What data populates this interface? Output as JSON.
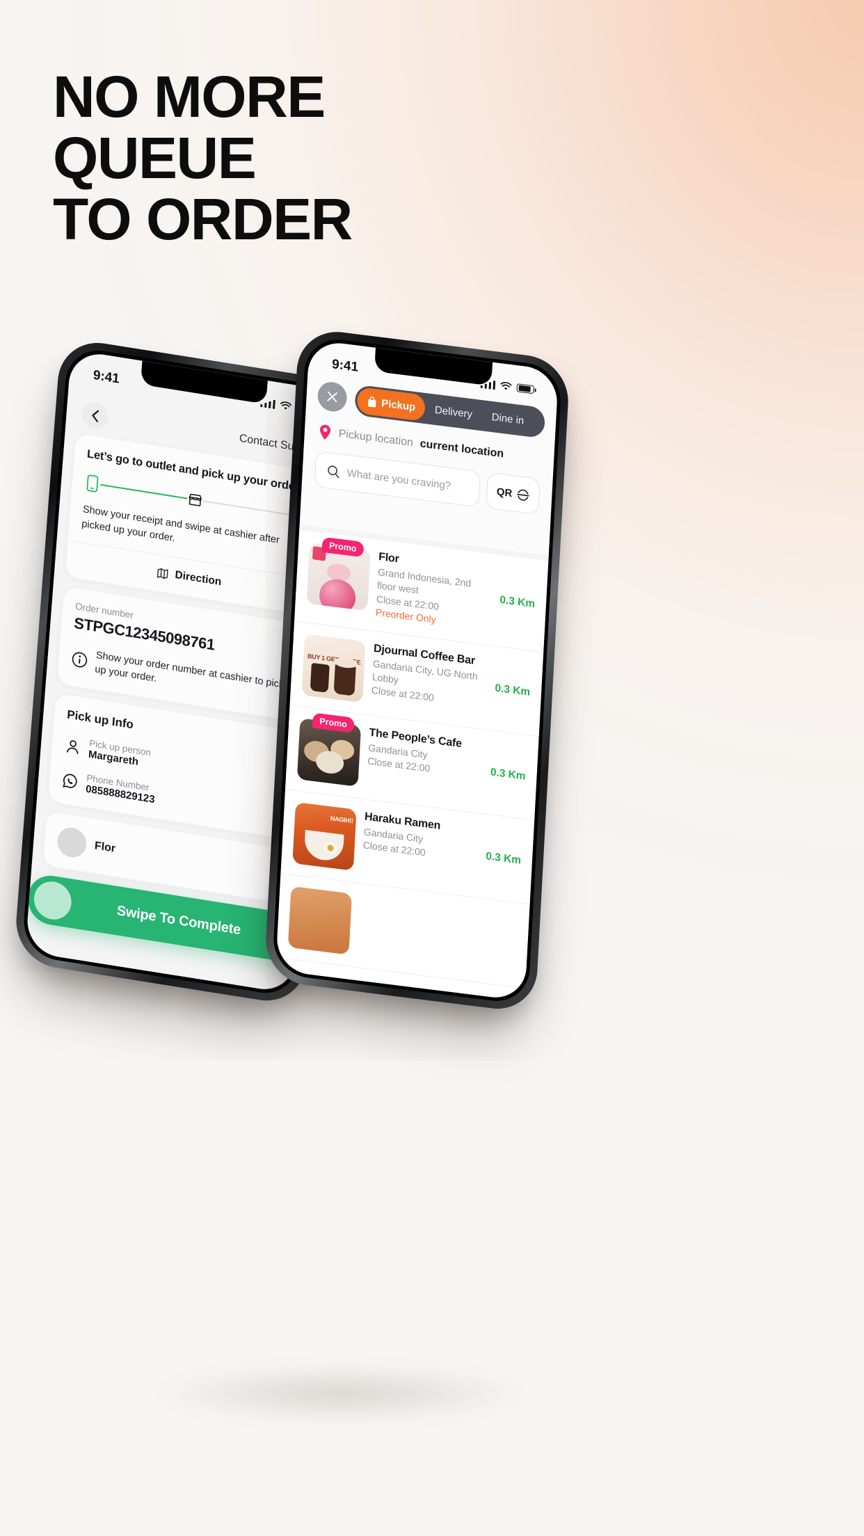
{
  "headline": {
    "line1": "NO MORE",
    "line2": "QUEUE",
    "line3": "TO ORDER"
  },
  "colors": {
    "accent_orange": "#f4711f",
    "promo_pink": "#f5246e",
    "distance_green": "#22b04b",
    "swipe_green": "#28b473",
    "preorder_orange": "#ef6e31",
    "tabs_dark": "#4c4f59"
  },
  "left_phone": {
    "status_bar": {
      "time": "9:41",
      "signal_icon": "cellular-bars-icon",
      "wifi_icon": "wifi-icon",
      "battery_icon": "battery-icon"
    },
    "header": {
      "back_icon": "chevron-left-icon",
      "support_label": "Contact Support"
    },
    "pickup_card": {
      "title": "Let’s go to outlet and pick up your order",
      "stepper": {
        "step1_icon": "phone-icon",
        "step2_icon": "store-icon",
        "step3_icon": "takeaway-bag-icon",
        "progress_done": 1
      },
      "subtitle": "Show your receipt and swipe at cashier after picked up your order.",
      "direction_icon": "map-icon",
      "direction_label": "Direction"
    },
    "order_card": {
      "label": "Order number",
      "value": "STPGC12345098761",
      "note_icon": "info-icon",
      "note": "Show your order number at cashier to pick-up your order."
    },
    "pickup_info": {
      "heading": "Pick up Info",
      "person_icon": "person-icon",
      "person_label": "Pick up person",
      "person_value": "Margareth",
      "phone_icon": "whatsapp-icon",
      "phone_label": "Phone Number",
      "phone_value": "085888829123"
    },
    "outlet": {
      "name": "Flor"
    },
    "swipe_button": {
      "label": "Swipe To Complete",
      "arrows_icon": "chevrons-right-icon"
    }
  },
  "right_phone": {
    "status_bar": {
      "time": "9:41",
      "signal_icon": "cellular-bars-icon",
      "wifi_icon": "wifi-icon",
      "battery_icon": "battery-icon"
    },
    "close_icon": "close-x-icon",
    "tabs": [
      {
        "label": "Pickup",
        "icon": "shopping-bag-icon",
        "active": true
      },
      {
        "label": "Delivery",
        "icon": "",
        "active": false
      },
      {
        "label": "Dine in",
        "icon": "",
        "active": false
      }
    ],
    "location": {
      "pin_icon": "location-pin-icon",
      "label": "Pickup location",
      "value": "current location"
    },
    "search": {
      "icon": "search-icon",
      "placeholder": "What are you craving?",
      "value": ""
    },
    "qr_button": {
      "label": "QR",
      "icon": "qr-scan-icon"
    },
    "restaurants": [
      {
        "name": "Flor",
        "address": "Grand Indonesia, 2nd floor west",
        "close": "Close at 22:00",
        "note": "Preorder Only",
        "distance": "0.3 Km",
        "promo": "Promo"
      },
      {
        "name": "Djournal Coffee Bar",
        "address": "Gandaria City, UG North Lobby",
        "close": "Close at 22:00",
        "note": "",
        "distance": "0.3 Km",
        "promo": ""
      },
      {
        "name": "The People’s Cafe",
        "address": "Gandaria City",
        "close": "Close at 22:00",
        "note": "",
        "distance": "0.3 Km",
        "promo": "Promo"
      },
      {
        "name": "Haraku Ramen",
        "address": "Gandaria City",
        "close": "Close at 22:00",
        "note": "",
        "distance": "0.3 Km",
        "promo": ""
      }
    ],
    "promo_image_texts": {
      "djournal": "BUY 1 GET 1 FREE",
      "haraku": "NAGIH!!"
    }
  }
}
